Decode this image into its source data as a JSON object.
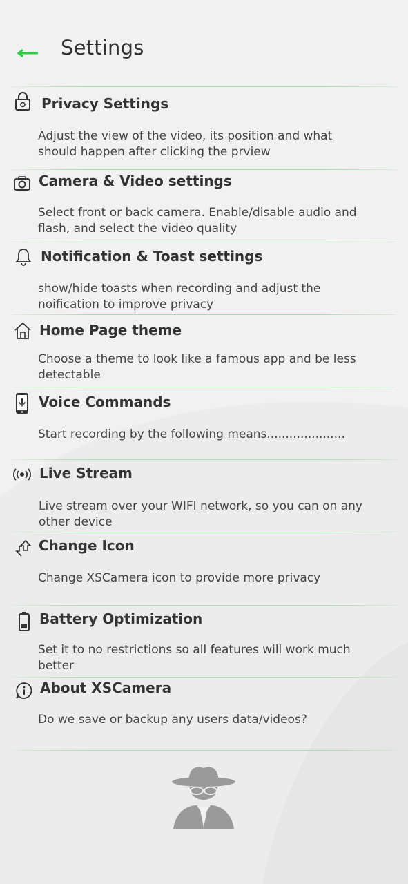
{
  "header": {
    "title": "Settings",
    "back_icon": "arrow-left-icon",
    "accent_color": "#2ecc40"
  },
  "items": [
    {
      "icon": "lock-icon",
      "title": "Privacy Settings",
      "desc": "Adjust the view of the video, its position and what should happen after clicking the prview"
    },
    {
      "icon": "camera-icon",
      "title": "Camera & Video settings",
      "desc": "Select front or back camera. Enable/disable audio and flash, and select the video quality"
    },
    {
      "icon": "bell-icon",
      "title": "Notification & Toast settings",
      "desc": "show/hide toasts when recording and adjust the noification to improve privacy"
    },
    {
      "icon": "home-icon",
      "title": "Home Page theme",
      "desc": "Choose a theme to look like a famous app and be less detectable"
    },
    {
      "icon": "phone-mic-icon",
      "title": "Voice Commands",
      "desc": "Start recording by the following  means....................."
    },
    {
      "icon": "broadcast-icon",
      "title": "Live Stream",
      "desc": "Live stream over your WIFI network, so you can on any other device"
    },
    {
      "icon": "swap-icon",
      "title": "Change Icon",
      "desc": "Change XSCamera icon to provide more privacy"
    },
    {
      "icon": "battery-icon",
      "title": "Battery Optimization",
      "desc": "Set it to no restrictions so all features will work much better"
    },
    {
      "icon": "info-icon",
      "title": "About XSCamera",
      "desc": "Do we save or backup any users data/videos?"
    }
  ],
  "footer": {
    "icon": "spy-icon"
  },
  "colors": {
    "divider": "#a5dfa5",
    "background": "#f1f1f1"
  }
}
